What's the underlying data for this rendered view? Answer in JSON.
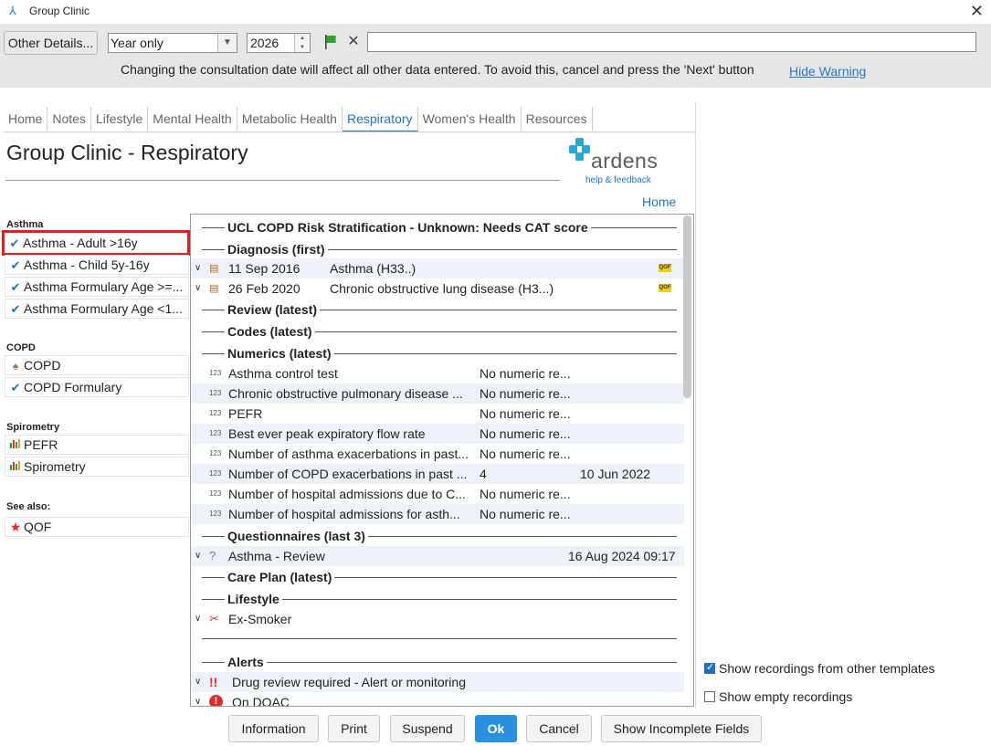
{
  "window": {
    "title": "Group Clinic"
  },
  "toolbar": {
    "other_details": "Other Details...",
    "period": "Year only",
    "year": "2026",
    "warning": "Changing the consultation date will affect all other data entered. To avoid this, cancel and press the 'Next' button",
    "hide_warning": "Hide Warning"
  },
  "tabs": [
    "Home",
    "Notes",
    "Lifestyle",
    "Mental Health",
    "Metabolic Health",
    "Respiratory",
    "Women's Health",
    "Resources"
  ],
  "active_tab": "Respiratory",
  "page": {
    "title": "Group Clinic - Respiratory",
    "home_link": "Home"
  },
  "brand": {
    "name": "ardens",
    "help": "help & feedback"
  },
  "sidebar": {
    "asthma_heading": "Asthma",
    "asthma_items": [
      "Asthma - Adult >16y",
      "Asthma - Child 5y-16y",
      "Asthma Formulary Age >=...",
      "Asthma Formulary Age <1..."
    ],
    "copd_heading": "COPD",
    "copd_items": [
      "COPD",
      "COPD Formulary"
    ],
    "spiro_heading": "Spirometry",
    "spiro_items": [
      "PEFR",
      "Spirometry"
    ],
    "see_heading": "See also:",
    "see_items": [
      "QOF"
    ]
  },
  "panel": {
    "h_risk": "UCL COPD Risk Stratification - Unknown: Needs CAT score",
    "h_diagnosis": "Diagnosis (first)",
    "diagnosis": [
      {
        "date": "11 Sep 2016",
        "desc": "Asthma (H33..)",
        "badge": "QOF"
      },
      {
        "date": "26 Feb 2020",
        "desc": "Chronic obstructive lung disease (H3...)",
        "badge": "QOF"
      }
    ],
    "h_review": "Review (latest)",
    "h_codes": "Codes (latest)",
    "h_numerics": "Numerics (latest)",
    "numerics": [
      {
        "name": "Asthma control test",
        "value": "No numeric re...",
        "date": ""
      },
      {
        "name": "Chronic obstructive pulmonary disease ...",
        "value": "No numeric re...",
        "date": ""
      },
      {
        "name": "PEFR",
        "value": "No numeric re...",
        "date": ""
      },
      {
        "name": "Best ever peak expiratory flow rate",
        "value": "No numeric re...",
        "date": ""
      },
      {
        "name": "Number of asthma exacerbations in past...",
        "value": "No numeric re...",
        "date": ""
      },
      {
        "name": "Number of COPD exacerbations in past ...",
        "value": "4",
        "date": "10 Jun 2022"
      },
      {
        "name": "Number of hospital admissions due to C...",
        "value": "No numeric re...",
        "date": ""
      },
      {
        "name": "Number of hospital admissions for asth...",
        "value": "No numeric re...",
        "date": ""
      }
    ],
    "h_questionnaires": "Questionnaires (last 3)",
    "questionnaire": {
      "name": "Asthma - Review",
      "date": "16 Aug 2024 09:17"
    },
    "h_careplan": "Care Plan (latest)",
    "h_lifestyle": "Lifestyle",
    "lifestyle": "Ex-Smoker",
    "h_alerts": "Alerts",
    "alerts": [
      "Drug review required - Alert or monitoring",
      "On DOAC"
    ]
  },
  "options": {
    "show_other": "Show recordings from other templates",
    "show_other_checked": true,
    "show_empty": "Show empty recordings",
    "show_empty_checked": false
  },
  "footer": {
    "information": "Information",
    "print": "Print",
    "suspend": "Suspend",
    "ok": "Ok",
    "cancel": "Cancel",
    "incomplete": "Show Incomplete Fields"
  },
  "colors": {
    "accent": "#1e73c5",
    "highlight": "#e21f1f",
    "ok_button": "#2b8fe0"
  }
}
